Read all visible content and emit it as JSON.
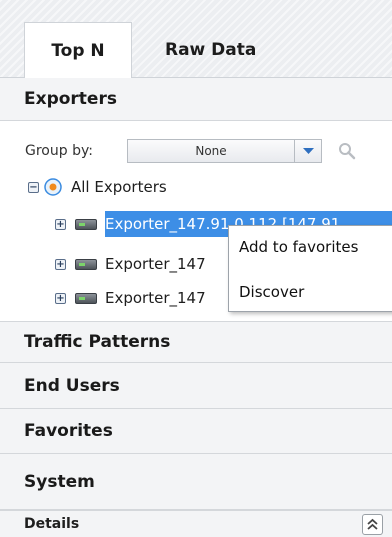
{
  "tabs": [
    {
      "label": "Top N",
      "active": true
    },
    {
      "label": "Raw Data",
      "active": false
    }
  ],
  "exporters_panel": {
    "title": "Exporters",
    "group_by_label": "Group by:",
    "group_by_value": "None",
    "tree": {
      "root_label": "All Exporters",
      "items": [
        {
          "label": "Exporter_147.91.0.112 [147.91",
          "selected": true
        },
        {
          "label": "Exporter_147",
          "selected": false
        },
        {
          "label": "Exporter_147",
          "selected": false
        }
      ]
    }
  },
  "context_menu": {
    "items": [
      "Add to favorites",
      "Discover"
    ]
  },
  "sections": [
    "Traffic Patterns",
    "End Users",
    "Favorites",
    "System"
  ],
  "details": {
    "label": "Details"
  },
  "icons": [
    "search-icon",
    "dropdown-arrow-icon",
    "collapse-all-icon",
    "expand-icon",
    "device-icon",
    "globe-icon",
    "collapse-icon"
  ],
  "colors": {
    "selection": "#3d8ee6",
    "header_bg": "#f3f4f6",
    "accent": "#3d8ee6"
  }
}
